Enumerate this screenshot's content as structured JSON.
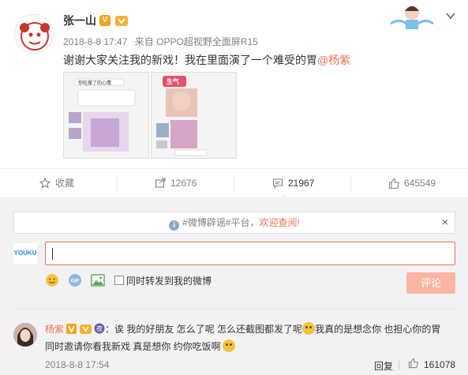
{
  "post": {
    "author": "张一山",
    "badge_v": "V",
    "time": "2018-8-8 17:47",
    "source_prefix": "来自",
    "source": "OPPO超视野全面屏R15",
    "text": "谢谢大家关注我的新戏！我在里面演了一个难受的胃",
    "mention": "@杨紫",
    "thumb1_text": "你吃撑了的心情",
    "thumb2_text": "生气"
  },
  "actions": {
    "favorite": "收藏",
    "forward_count": "12676",
    "comment_count": "21967",
    "like_count": "645549"
  },
  "comment_box": {
    "notice_prefix": "#微博辟谣#平台，",
    "notice_highlight": "欢迎查阅!",
    "close": "×",
    "youku": "YOUKU",
    "forward_label": "同时转发到我的微博",
    "submit_label": "评论",
    "input_value": ""
  },
  "comment": {
    "author": "杨紫",
    "text_line1_a": "：诶 我的好朋友 怎么了呢 怎么还截图都发了呢",
    "text_line1_b": "我真的是想念你 也担心你的胃",
    "text_line2": "同时邀请你看我新戏 真是想你 约你吃饭啊",
    "time": "2018-8-8 17:54",
    "reply_label": "回复",
    "like_count": "161078"
  },
  "colors": {
    "accent": "#eb7350",
    "submit_disabled": "#fbb5a0",
    "comment_bg": "#f2f2f5"
  }
}
